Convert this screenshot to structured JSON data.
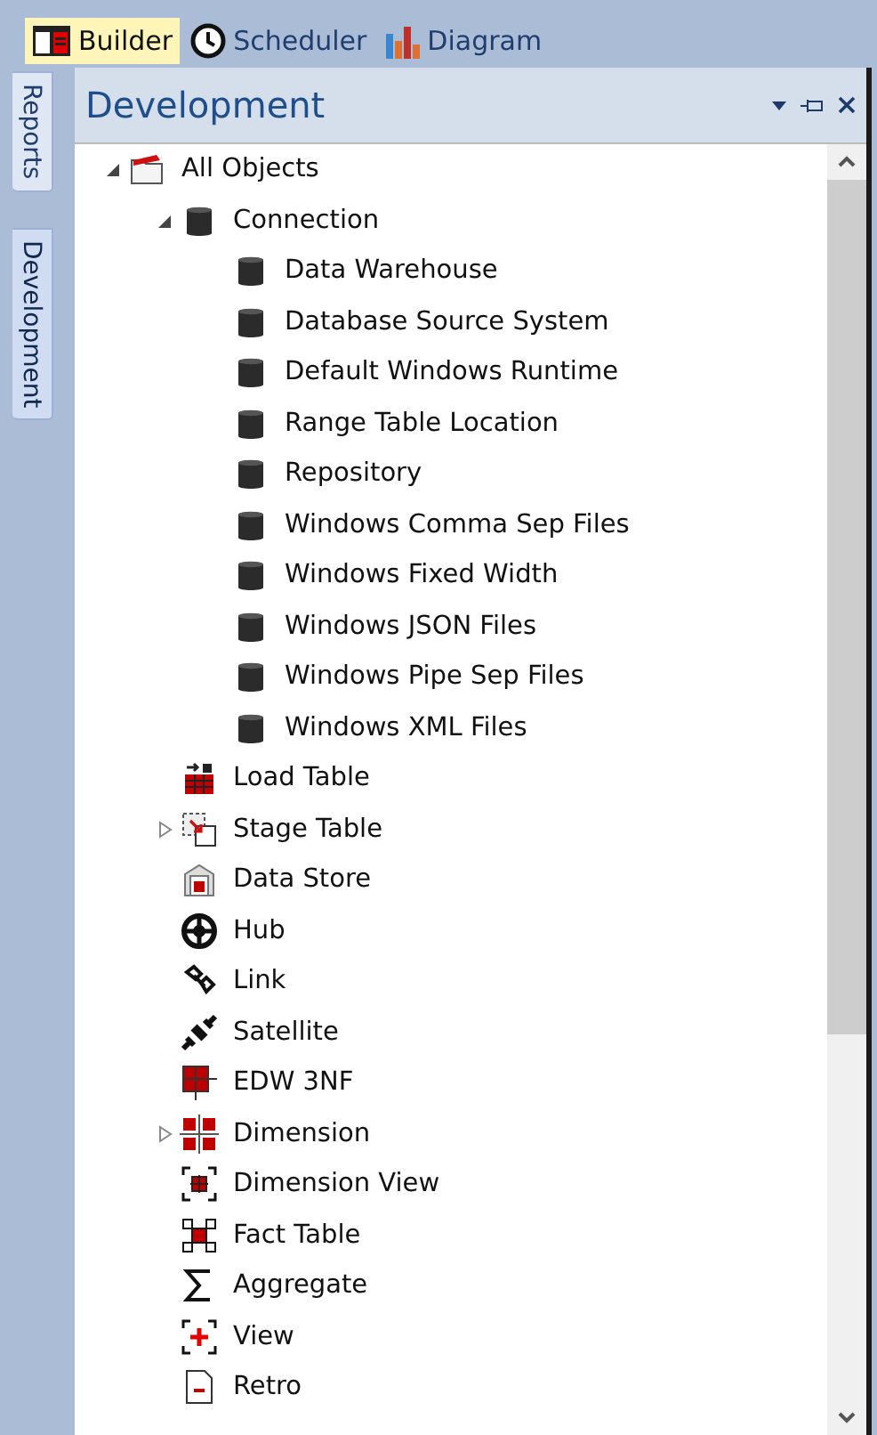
{
  "tabs": [
    {
      "label": "Builder",
      "kind": "builder",
      "selected": true
    },
    {
      "label": "Scheduler",
      "kind": "clock",
      "selected": false
    },
    {
      "label": "Diagram",
      "kind": "chart",
      "selected": false
    }
  ],
  "side_tabs": [
    {
      "label": "Reports",
      "selected": false
    },
    {
      "label": "Development",
      "selected": true
    }
  ],
  "panel": {
    "title": "Development"
  },
  "tree": [
    {
      "label": "All Objects",
      "kind": "folder",
      "expandable": true,
      "expanded": true,
      "children": [
        {
          "label": "Connection",
          "kind": "database",
          "expandable": true,
          "expanded": true,
          "children": [
            {
              "label": "Data Warehouse",
              "kind": "database",
              "expandable": false
            },
            {
              "label": "Database Source System",
              "kind": "database",
              "expandable": false
            },
            {
              "label": "Default Windows Runtime",
              "kind": "database",
              "expandable": false
            },
            {
              "label": "Range Table Location",
              "kind": "database",
              "expandable": false
            },
            {
              "label": "Repository",
              "kind": "database",
              "expandable": false
            },
            {
              "label": "Windows Comma Sep Files",
              "kind": "database",
              "expandable": false
            },
            {
              "label": "Windows Fixed Width",
              "kind": "database",
              "expandable": false
            },
            {
              "label": "Windows JSON Files",
              "kind": "database",
              "expandable": false
            },
            {
              "label": "Windows Pipe Sep Files",
              "kind": "database",
              "expandable": false
            },
            {
              "label": "Windows XML Files",
              "kind": "database",
              "expandable": false
            }
          ]
        },
        {
          "label": "Load Table",
          "kind": "load",
          "expandable": false
        },
        {
          "label": "Stage Table",
          "kind": "stage",
          "expandable": true,
          "expanded": false
        },
        {
          "label": "Data Store",
          "kind": "store",
          "expandable": false
        },
        {
          "label": "Hub",
          "kind": "hub",
          "expandable": false
        },
        {
          "label": "Link",
          "kind": "link",
          "expandable": false
        },
        {
          "label": "Satellite",
          "kind": "satellite",
          "expandable": false
        },
        {
          "label": "EDW 3NF",
          "kind": "edw",
          "expandable": false
        },
        {
          "label": "Dimension",
          "kind": "dimension",
          "expandable": true,
          "expanded": false
        },
        {
          "label": "Dimension View",
          "kind": "dimview",
          "expandable": false
        },
        {
          "label": "Fact Table",
          "kind": "fact",
          "expandable": false
        },
        {
          "label": "Aggregate",
          "kind": "aggregate",
          "expandable": false
        },
        {
          "label": "View",
          "kind": "view",
          "expandable": false
        },
        {
          "label": "Retro",
          "kind": "retro",
          "expandable": false
        }
      ]
    }
  ]
}
